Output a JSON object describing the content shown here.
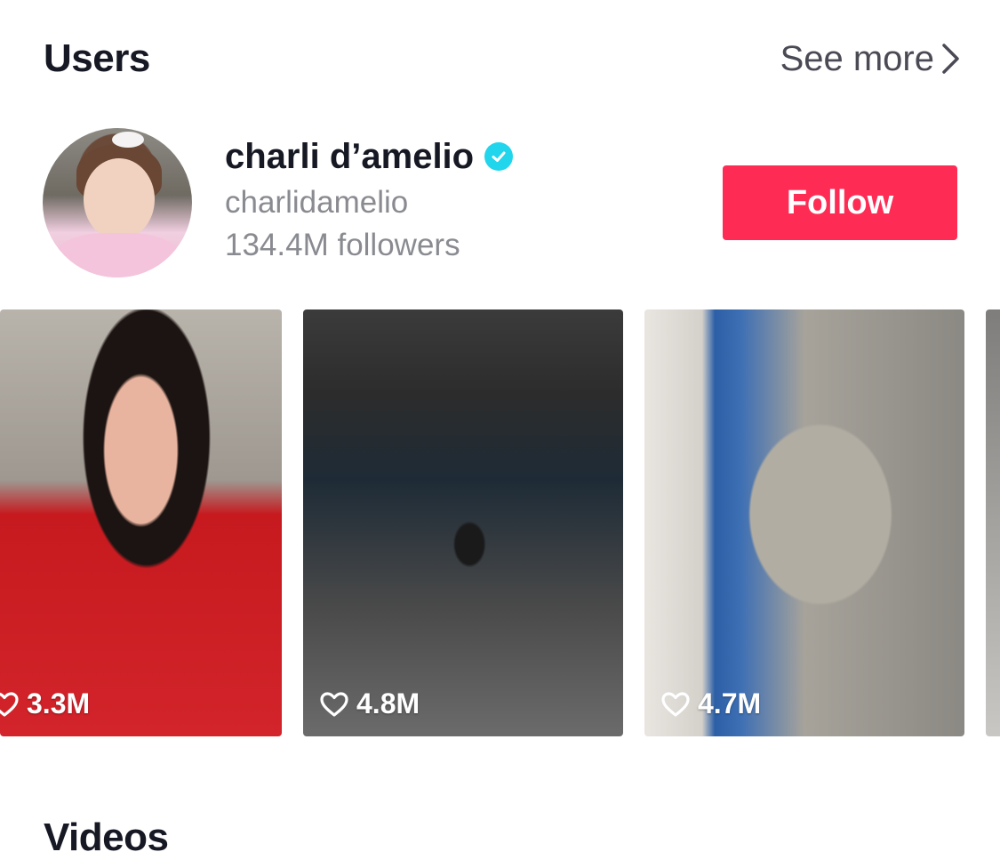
{
  "users_section": {
    "title": "Users",
    "see_more_label": "See more"
  },
  "user": {
    "display_name": "charli d’amelio",
    "verified": true,
    "handle": "charlidamelio",
    "followers": "134.4M followers",
    "follow_label": "Follow"
  },
  "videos": [
    {
      "likes": "3.3M"
    },
    {
      "likes": "4.8M"
    },
    {
      "likes": "4.7M"
    }
  ],
  "videos_section": {
    "title": "Videos"
  },
  "colors": {
    "follow_button": "#fe2c55",
    "verified_badge": "#20d5ec",
    "secondary_text": "#8a8b91",
    "primary_text": "#161823"
  },
  "icons": {
    "see_more": "chevron-right-icon",
    "verified": "verified-check-icon",
    "likes": "heart-outline-icon"
  }
}
